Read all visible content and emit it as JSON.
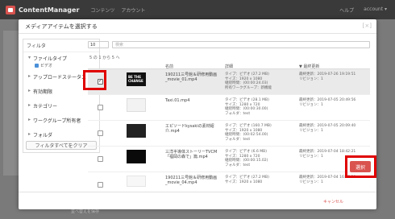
{
  "app": {
    "logo": "ContentManager",
    "nav": [
      "コンテンツ",
      "アカウント"
    ],
    "right": [
      "ヘルプ",
      "account ▾"
    ]
  },
  "background": {
    "footer_text": "並べ替えを保存"
  },
  "modal": {
    "title": "メディアアイテムを選択する",
    "close": "[×]",
    "filters": {
      "heading": "フィルタ",
      "groups": [
        {
          "label": "ファイルタイプ",
          "expanded": true,
          "sub": "ビデオ"
        },
        {
          "label": "アップロードステータス",
          "expanded": false
        },
        {
          "label": "有効期限",
          "expanded": false
        },
        {
          "label": "カテゴリー",
          "expanded": false
        },
        {
          "label": "ワークグループ所有者",
          "expanded": false
        },
        {
          "label": "フォルダ",
          "expanded": false
        }
      ],
      "clear_button": "フィルタすべてをクリア"
    },
    "toolbar": {
      "page_size": "10",
      "search_placeholder": "検索"
    },
    "count_text": "5 の 1 から 5 へ",
    "columns": {
      "name": "名前",
      "detail": "詳細",
      "updated": "▼ 最終更新"
    },
    "rows": [
      {
        "selected": true,
        "thumb": "dark",
        "thumb_text": "BE THE CHANGE",
        "name": "190211三号館＆研修用動画_movie_01.mp4",
        "detail": [
          "タイプ：ビデオ (27.2 MB)",
          "サイズ：1920 x 1080",
          "継続時間：(00:00:24.03)",
          "所有ワークグループ：新機能"
        ],
        "date": [
          "最終更新：2019-07-26 19:19:51",
          "リビジョン：1"
        ]
      },
      {
        "selected": false,
        "thumb": "light",
        "thumb_text": "",
        "name": "Taxi.01.mp4",
        "detail": [
          "タイプ：ビデオ (28.1 MB)",
          "サイズ：1280 x 720",
          "継続時間：(00:00:30.00)",
          "フォルダ：test"
        ],
        "date": [
          "最終更新：2019-07-05 20:49:56",
          "リビジョン：1"
        ]
      },
      {
        "selected": false,
        "thumb": "dark2",
        "thumb_text": "",
        "name": "エピソードkysakiの素材紹介.mp4",
        "detail": [
          "タイプ：ビデオ (160.7 MB)",
          "サイズ：1920 x 1080",
          "継続時間：(00:02:54.00)",
          "フォルダ：test"
        ],
        "date": [
          "最終更新：2019-07-05 20:09:40",
          "リビジョン：1"
        ]
      },
      {
        "selected": false,
        "thumb": "dark3",
        "thumb_text": "",
        "name": "三洋半導体ストーリーTVCM「福岡の森で」篇.mp4",
        "detail": [
          "タイプ：ビデオ (6.6 MB)",
          "サイズ：1280 x 720",
          "継続時間：(00:00:15.02)",
          "フォルダ：test"
        ],
        "date": [
          "最終更新：2019-07-04 18:42:21",
          "リビジョン：1"
        ]
      },
      {
        "selected": false,
        "thumb": "light2",
        "thumb_text": "",
        "name": "190211三号館＆研修用動画_movie_04.mp4",
        "detail": [
          "タイプ：ビデオ (27.2 MB)",
          "サイズ：1920 x 1080"
        ],
        "date": [
          "最終更新：2019-07-04 16:17:20",
          "リビジョン：1"
        ]
      }
    ],
    "footer": {
      "cancel": "キャンセル",
      "select": "選択"
    }
  },
  "colors": {
    "accent": "#d9534f",
    "highlight": "#e00000",
    "topbar": "#3a3a3a"
  }
}
